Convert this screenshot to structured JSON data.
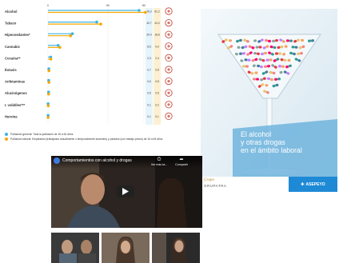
{
  "chart": {
    "tick_labels": [
      "0",
      "50",
      "80"
    ],
    "categories": [
      {
        "label": "Alcohol",
        "v1": "76,0",
        "v2": "81,2"
      },
      {
        "label": "Tabaco",
        "v1": "40,7",
        "v2": "44,0"
      },
      {
        "label": "Hipnosedantes*",
        "v1": "20,4",
        "v2": "18,8"
      },
      {
        "label": "Cannabis",
        "v1": "8,5",
        "v2": "9,9"
      },
      {
        "label": "Cocaína**",
        "v1": "2,3",
        "v2": "2,4"
      },
      {
        "label": "Éxtasis",
        "v1": "0,7",
        "v2": "0,8"
      },
      {
        "label": "Anfetaminas",
        "v1": "0,6",
        "v2": "0,8"
      },
      {
        "label": "Alucinógenos",
        "v1": "0,5",
        "v2": "0,5"
      },
      {
        "label": "I. volátiles***",
        "v1": "0,1",
        "v2": "0,2"
      },
      {
        "label": "Heroína",
        "v1": "0,1",
        "v2": "0,1"
      }
    ],
    "legend": [
      "Población general: Toda la población de 15 a 64 años",
      "Población laboral: Empleados (trabajando actualmente o temporalmente ausentes) y parados (con trabajo previo) de 16 a 64 años"
    ]
  },
  "chart_data": {
    "type": "bar",
    "categories": [
      "Alcohol",
      "Tabaco",
      "Hipnosedantes*",
      "Cannabis",
      "Cocaína**",
      "Éxtasis",
      "Anfetaminas",
      "Alucinógenos",
      "I. volátiles***",
      "Heroína"
    ],
    "series": [
      {
        "name": "Población general",
        "values": [
          76.0,
          40.7,
          20.4,
          8.5,
          2.3,
          0.7,
          0.6,
          0.5,
          0.1,
          0.1
        ]
      },
      {
        "name": "Población laboral",
        "values": [
          81.2,
          44.0,
          18.8,
          9.9,
          2.4,
          0.8,
          0.8,
          0.5,
          0.2,
          0.1
        ]
      }
    ],
    "xlim": [
      0,
      80
    ],
    "orientation": "horizontal"
  },
  "colors": {
    "general": "#3db4e6",
    "laboral": "#f6a800",
    "icon_ring": "#c0392b",
    "panel_blue": "#1e8ad6"
  },
  "brochure": {
    "title_lines": [
      "El alcohol",
      "y otras drogas",
      "en el ámbito laboral"
    ],
    "logo_left_script": "Grupo",
    "logo_left_text": "GRUPATRA",
    "logo_right": "ASEPEYO"
  },
  "video": {
    "title": "Comportamientos con alcohol y drogas",
    "watch_later": "Ver más ta...",
    "share": "Compartir"
  }
}
